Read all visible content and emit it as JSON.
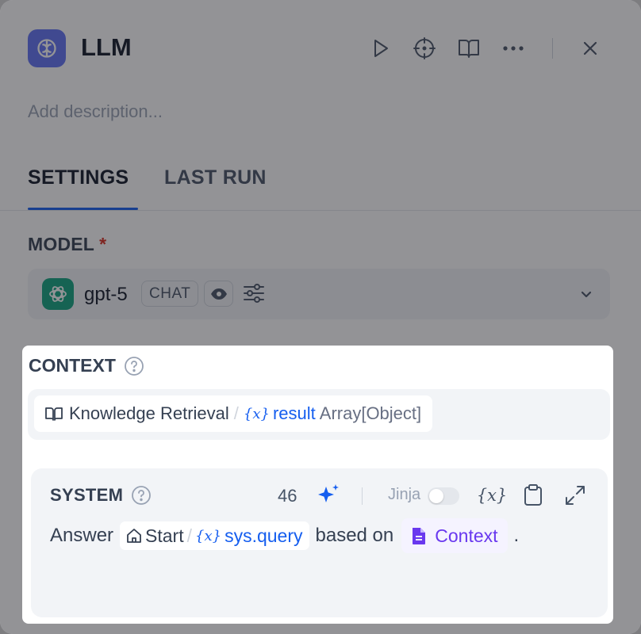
{
  "header": {
    "title": "LLM",
    "description_placeholder": "Add description..."
  },
  "tabs": [
    {
      "label": "SETTINGS",
      "active": true
    },
    {
      "label": "LAST RUN",
      "active": false
    }
  ],
  "model": {
    "section_label": "MODEL",
    "required_mark": "*",
    "name": "gpt-5",
    "mode_badge": "CHAT"
  },
  "context": {
    "section_label": "CONTEXT",
    "node_name": "Knowledge Retrieval",
    "separator": "/",
    "variable_name": "result",
    "variable_type": "Array[Object]"
  },
  "system": {
    "label": "SYSTEM",
    "token_count": "46",
    "jinja_label": "Jinja",
    "jinja_enabled": false,
    "prompt": {
      "prefix": "Answer",
      "chip_node": "Start",
      "chip_separator": "/",
      "chip_variable": "sys.query",
      "middle": "based on",
      "context_chip": "Context",
      "suffix": "."
    }
  },
  "colors": {
    "accent": "#155eef",
    "node_icon": "#6172f3",
    "openai_green": "#10a37f",
    "context_purple": "#6938ef",
    "required_red": "#d92d20"
  }
}
